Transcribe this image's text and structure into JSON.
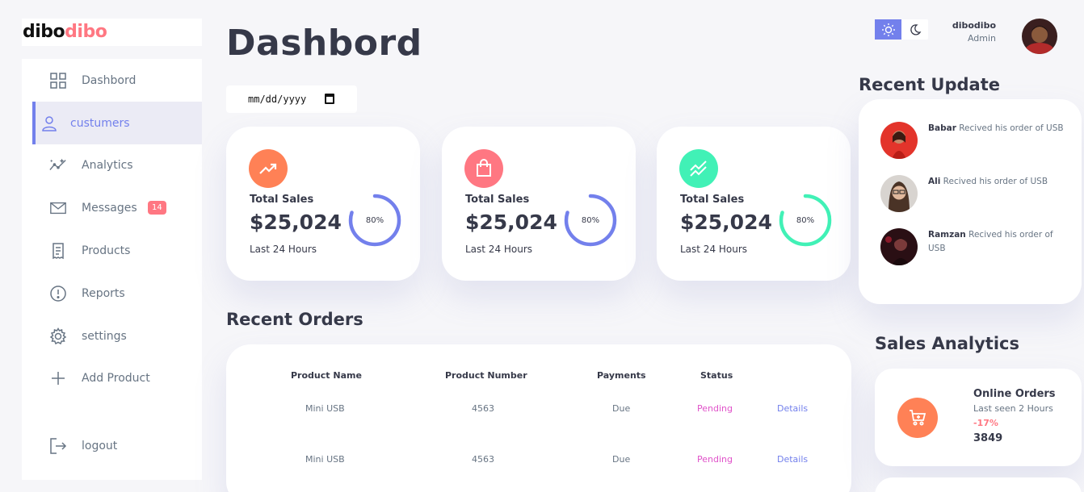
{
  "logo": {
    "part1": "dibo",
    "part2": "dibo"
  },
  "sidebar": {
    "items": [
      {
        "label": "Dashbord",
        "icon": "grid-icon",
        "active": false
      },
      {
        "label": "custumers",
        "icon": "person-icon",
        "active": true
      },
      {
        "label": "Analytics",
        "icon": "insights-icon",
        "active": false
      },
      {
        "label": "Messages",
        "icon": "mail-icon",
        "active": false,
        "badge": "14"
      },
      {
        "label": "Products",
        "icon": "receipt-icon",
        "active": false
      },
      {
        "label": "Reports",
        "icon": "report-icon",
        "active": false
      },
      {
        "label": "settings",
        "icon": "gear-icon",
        "active": false
      },
      {
        "label": "Add Product",
        "icon": "plus-icon",
        "active": false
      },
      {
        "label": "logout",
        "icon": "logout-icon",
        "active": false
      }
    ]
  },
  "main": {
    "title": "Dashbord",
    "date_placeholder": "mm/dd/yyyy",
    "cards": [
      {
        "title": "Total Sales",
        "amount": "$25,024",
        "sub": "Last 24 Hours",
        "percent": "80%",
        "percent_value": 0.8,
        "icon": "trending-up-icon",
        "color": "#ff8156",
        "ring_color": "#7380ec"
      },
      {
        "title": "Total Sales",
        "amount": "$25,024",
        "sub": "Last 24 Hours",
        "percent": "80%",
        "percent_value": 0.8,
        "icon": "shopping-bag-icon",
        "color": "#ff7782",
        "ring_color": "#7380ec"
      },
      {
        "title": "Total Sales",
        "amount": "$25,024",
        "sub": "Last 24 Hours",
        "percent": "80%",
        "percent_value": 0.8,
        "icon": "stacked-line-icon",
        "color": "#41f1b6",
        "ring_color": "#41f1b6"
      }
    ],
    "recent_orders": {
      "title": "Recent Orders",
      "headers": [
        "Product Name",
        "Product Number",
        "Payments",
        "Status"
      ],
      "rows": [
        {
          "name": "Mini USB",
          "number": "4563",
          "payment": "Due",
          "status": "Pending",
          "action": "Details"
        },
        {
          "name": "Mini USB",
          "number": "4563",
          "payment": "Due",
          "status": "Pending",
          "action": "Details"
        }
      ]
    }
  },
  "right": {
    "theme": {
      "light_icon": "sun-icon",
      "dark_icon": "moon-icon"
    },
    "user": {
      "name": "dibodibo",
      "role": "Admin"
    },
    "recent_update": {
      "title": "Recent Update",
      "items": [
        {
          "name": "Babar",
          "text": "Recived his order of USB"
        },
        {
          "name": "Ali",
          "text": "Recived his order of USB"
        },
        {
          "name": "Ramzan",
          "text": "Recived his order of USB"
        }
      ]
    },
    "sales_analytics": {
      "title": "Sales Analytics",
      "item": {
        "title": "Online Orders",
        "sub": "Last seen 2 Hours",
        "percent": "-17%",
        "value": "3849"
      }
    }
  },
  "colors": {
    "primary": "#7380ec",
    "danger": "#ff7782",
    "success": "#41f1b6",
    "warning": "#ffbb55",
    "dark": "#363949",
    "info": "#677483"
  }
}
